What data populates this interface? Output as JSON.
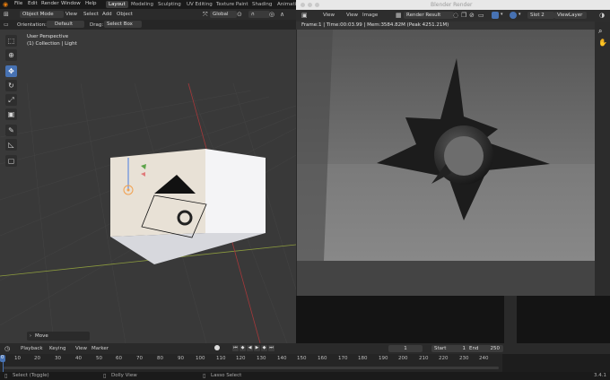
{
  "menubar": {
    "items": [
      "File",
      "Edit",
      "Render",
      "Window",
      "Help"
    ],
    "workspaces": [
      "Layout",
      "Modeling",
      "Sculpting",
      "UV Editing",
      "Texture Paint",
      "Shading",
      "Animati"
    ],
    "active_workspace": "Layout"
  },
  "viewport_header": {
    "mode": "Object Mode",
    "menus": [
      "View",
      "Select",
      "Add",
      "Object"
    ],
    "transform_orientation": "Global"
  },
  "tool_settings": {
    "orientation_label": "Orientation:",
    "orientation_value": "Default",
    "drag_label": "Drag:",
    "drag_value": "Select Box"
  },
  "viewport_overlay": {
    "line1": "User Perspective",
    "line2": "(1) Collection | Light"
  },
  "last_operator": "Move",
  "render_window": {
    "title": "Blender Render",
    "menus": [
      "View",
      "View",
      "Image"
    ],
    "image_name": "Render Result",
    "slot": "Slot 2",
    "view_layer": "ViewLayer",
    "status": "Frame:1 | Time:00:03.99 | Mem:3584.82M (Peak 4251.21M)"
  },
  "timeline": {
    "menus": [
      "Playback",
      "Keying",
      "View",
      "Marker"
    ],
    "current_frame": "1",
    "start_label": "Start",
    "start_value": "1",
    "end_label": "End",
    "end_value": "250",
    "ruler": [
      "10",
      "20",
      "30",
      "40",
      "50",
      "60",
      "70",
      "80",
      "90",
      "100",
      "110",
      "120",
      "130",
      "140",
      "150",
      "160",
      "170",
      "180",
      "190",
      "200",
      "210",
      "220",
      "230",
      "240"
    ],
    "current_marker": "0"
  },
  "statusbar": {
    "left": "Select (Toggle)",
    "middle": "Dolly View",
    "right": "Lasso Select",
    "version": "3.4.1"
  },
  "colors": {
    "accent": "#4772b3",
    "viewport_bg": "#393939",
    "render_bg": "#5c5c5c"
  }
}
